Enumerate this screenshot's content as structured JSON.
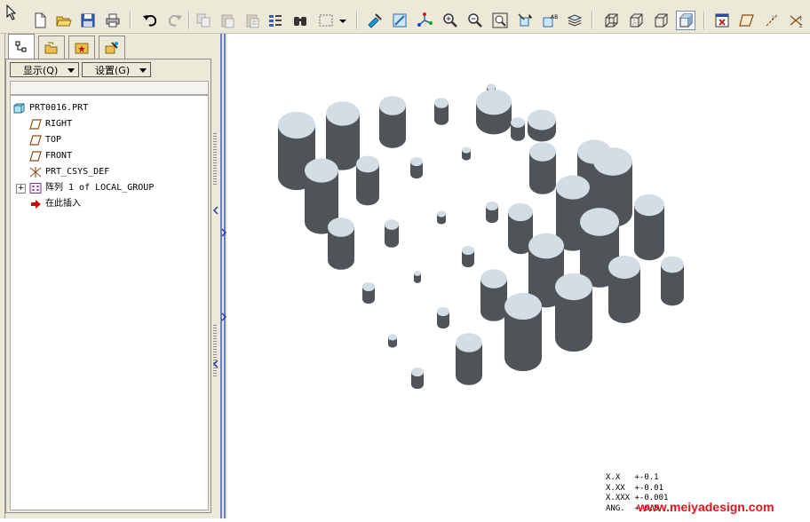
{
  "toolbar": {
    "icons": [
      "new-icon",
      "open-icon",
      "save-icon",
      "print-icon",
      "undo-icon",
      "redo-icon",
      "copy-icon",
      "paste-icon",
      "paste-special-icon",
      "regenerate-icon",
      "find-icon",
      "select-box-icon",
      "select-dropdown-icon",
      "repaint-icon",
      "orient-icon",
      "spin-center-icon",
      "zoom-in-icon",
      "zoom-out-icon",
      "refit-icon",
      "reorient-icon",
      "saved-views-icon",
      "layers-icon",
      "wireframe-icon",
      "hidden-line-icon",
      "no-hidden-icon",
      "shading-icon",
      "datum-planes-icon",
      "datum-axes-icon",
      "csys-icon"
    ]
  },
  "model_tree": {
    "tabs": [
      "model-tree-tab",
      "folder-browser-tab",
      "favorites-tab",
      "connections-tab"
    ],
    "show_menu_label": "显示(Q)",
    "settings_menu_label": "设置(G)",
    "items": [
      {
        "label": "PRT0016.PRT",
        "icon": "part-icon"
      },
      {
        "label": "RIGHT",
        "icon": "datum-plane-icon"
      },
      {
        "label": "TOP",
        "icon": "datum-plane-icon"
      },
      {
        "label": "FRONT",
        "icon": "datum-plane-icon"
      },
      {
        "label": "PRT_CSYS_DEF",
        "icon": "csys-icon"
      },
      {
        "label": "阵列 1 of LOCAL_GROUP",
        "icon": "pattern-icon"
      },
      {
        "label": "在此插入",
        "icon": "insert-here-arrow-icon"
      }
    ]
  },
  "viewport": {
    "cylinder_body_color": "#4f5458",
    "cylinder_top_color": "#d3dde6"
  },
  "accuracy": {
    "lines": [
      "X.X   +-0.1",
      "X.XX  +-0.01",
      "X.XXX +-0.001",
      "ANG.  +-0.5"
    ]
  },
  "watermark": "www.meiyadesign.com"
}
